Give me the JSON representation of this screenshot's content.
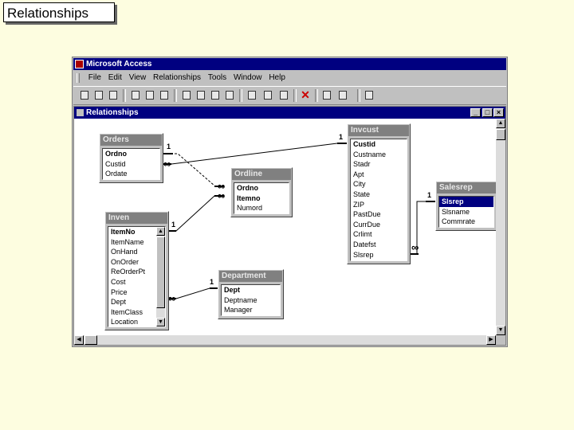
{
  "slide": {
    "title": "Relationships"
  },
  "app": {
    "title": "Microsoft Access",
    "menu": [
      "File",
      "Edit",
      "View",
      "Relationships",
      "Tools",
      "Window",
      "Help"
    ],
    "window_title": "Relationships"
  },
  "tables": {
    "orders": {
      "title": "Orders",
      "fields": [
        "Ordno",
        "Custid",
        "Ordate"
      ],
      "keys": [
        0
      ]
    },
    "ordline": {
      "title": "Ordline",
      "fields": [
        "Ordno",
        "Itemno",
        "Numord"
      ],
      "keys": [
        0,
        1
      ]
    },
    "invcust": {
      "title": "Invcust",
      "fields": [
        "Custid",
        "Custname",
        "Stadr",
        "Apt",
        "City",
        "State",
        "ZIP",
        "PastDue",
        "CurrDue",
        "Crlimt",
        "Datefst",
        "Slsrep"
      ],
      "keys": [
        0
      ]
    },
    "salesrep": {
      "title": "Salesrep",
      "fields": [
        "Slsrep",
        "Slsname",
        "Commrate"
      ],
      "keys": [
        0
      ],
      "selected": 0
    },
    "inven": {
      "title": "Inven",
      "fields": [
        "ItemNo",
        "ItemName",
        "OnHand",
        "OnOrder",
        "ReOrderPt",
        "Cost",
        "Price",
        "Dept",
        "ItemClass",
        "Location"
      ],
      "keys": [
        0
      ]
    },
    "department": {
      "title": "Department",
      "fields": [
        "Dept",
        "Deptname",
        "Manager"
      ],
      "keys": [
        0
      ]
    }
  },
  "relationships": {
    "one": "1",
    "many": "∞"
  }
}
